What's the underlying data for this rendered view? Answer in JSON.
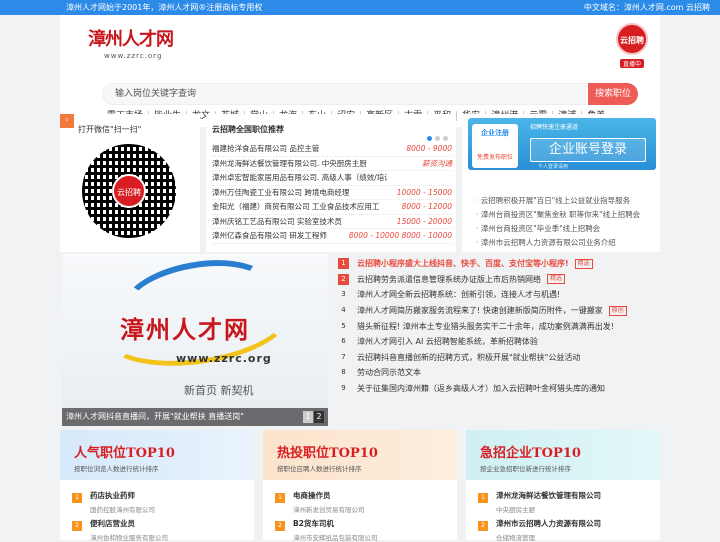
{
  "topbar": {
    "left": "漳州人才网始于2001年，漳州人才网®注册商标专用权",
    "right": "中文域名：漳州人才网.com 云招聘"
  },
  "logo": {
    "title": "漳州人才网",
    "url": "www.zzrc.org"
  },
  "live": {
    "logo": "云招聘",
    "label": "直播中"
  },
  "search": {
    "placeholder": "输入岗位关键字查询",
    "button": "搜索职位"
  },
  "cities": [
    "零工市场",
    "毕业生",
    "龙文",
    "芗城",
    "常山",
    "龙海",
    "东山",
    "诏安",
    "高新区",
    "古雷",
    "平和",
    "华安",
    "漳州港",
    "云霄",
    "漳浦",
    "角美"
  ],
  "qr": {
    "title": "打开微信\"扫一扫\"",
    "center": "云招聘"
  },
  "jobs": {
    "title": "云招聘全国职位推荐",
    "list": [
      {
        "name": "福建抢洋食品有限公司 品控主管",
        "salary": "8000 - 9000"
      },
      {
        "name": "漳州龙海鲜达餐饮管理有限公司. 中央厨房主厨",
        "salary": "薪资沟通"
      },
      {
        "name": "漳州卓宏智能家居用品有限公司. 高级人事（绩效/培训方�.",
        "salary": ""
      },
      {
        "name": "漳州万佳陶瓷工业有限公司 跨境电商经理",
        "salary": "10000 - 15000"
      },
      {
        "name": "金阳光（福建）商贸有限公司 工业食品技术应用工",
        "salary": "8000 - 12000"
      },
      {
        "name": "漳州庆铭工艺品有限公司 实验室技术员",
        "salary": "15000 - 20000"
      },
      {
        "name": "漳州亿森食品有限公司 研发工程师",
        "salary": "8000 - 10000 8000 - 10000"
      }
    ]
  },
  "adv": {
    "badge": "企业注册",
    "free": "免费发布职位",
    "title": "企业账号登录",
    "sub1": "招聘快速注册通道",
    "sub2": "个人登录请用",
    "news": [
      "云招聘积极开展\"百日\"线上公益就业指导服务",
      "漳州台商投资区\"聚焦金秋 职等你来\"线上招聘会",
      "漳州台商投资区\"毕业季\"线上招聘会",
      "漳州市云招聘人力资源有限公司业务介绍"
    ]
  },
  "slide": {
    "title": "漳州人才网",
    "url": "www.zzrc.org",
    "sub": "新首页 新契机",
    "caption": "漳州人才网抖音直播间，开展\"就业帮扶 直播送岗\"",
    "pages": [
      "1",
      "2"
    ]
  },
  "newslist": [
    {
      "n": "1",
      "t": "云招聘小程序盛大上线抖音、快手、百度、支付宝等小程序!",
      "tag": "精选",
      "hl": true
    },
    {
      "n": "2",
      "t": "云招聘劳务派遣信息管理系统办证版上市后热销网络",
      "tag": "精选"
    },
    {
      "n": "3",
      "t": "漳州人才网全新云招聘系统：创新引领，连接人才与机遇!",
      "tag": ""
    },
    {
      "n": "4",
      "t": "漳州人才网简历搬家服务流程来了! 快速创建新版简历附件，一键搬家",
      "tag": "原创"
    },
    {
      "n": "5",
      "t": "猎头新征程! 漳州本土专业猎头服务实干二十余年，成功案例满满再出发!",
      "tag": ""
    },
    {
      "n": "6",
      "t": "漳州人才网引入 AI 云招聘智能系统，革新招聘体验",
      "tag": ""
    },
    {
      "n": "7",
      "t": "云招聘抖音直播创新的招聘方式，积极开展\"就业帮扶\"公益活动",
      "tag": ""
    },
    {
      "n": "8",
      "t": "劳动合同示范文本",
      "tag": ""
    },
    {
      "n": "9",
      "t": "关于征集国内漳州籍（返乡高级人才）加入云招聘叶金柯猎头库的通知",
      "tag": ""
    }
  ],
  "cards": [
    {
      "title": "人气职位TOP10",
      "sub": "按职位浏览人数进行统计排序",
      "items": [
        {
          "n": "1",
          "a": "药店执业药师",
          "b": "国药控股漳州有限公司"
        },
        {
          "n": "2",
          "a": "便利店营业员",
          "b": "漳州协和物业服务有限公司"
        }
      ]
    },
    {
      "title": "热投职位TOP10",
      "sub": "按职位应聘人数进行统计排序",
      "items": [
        {
          "n": "1",
          "a": "电商操作员",
          "b": "漳州新发创贸易有限公司"
        },
        {
          "n": "2",
          "a": "B2货车司机",
          "b": "漳州市安辉纸品包装有限公司"
        }
      ]
    },
    {
      "title": "急招企业TOP10",
      "sub": "按企业急招职位新进行统计排序",
      "items": [
        {
          "n": "1",
          "a": "漳州龙海鲜达餐饮管理有限公司",
          "b": "中央厨房主厨"
        },
        {
          "n": "2",
          "a": "漳州市云招聘人力资源有限公司",
          "b": "仓储物流管理"
        }
      ]
    }
  ]
}
